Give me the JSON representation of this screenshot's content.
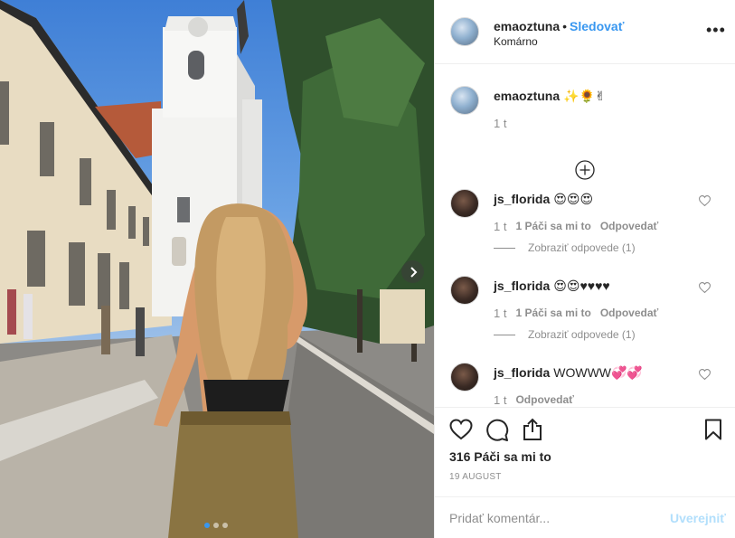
{
  "header": {
    "username": "emaoztuna",
    "separator": "•",
    "follow_label": "Sledovať",
    "location": "Komárno",
    "more_label": "•••"
  },
  "caption": {
    "username": "emaoztuna",
    "text": "✨🌻✌",
    "time": "1 t"
  },
  "comments": [
    {
      "username": "js_florida",
      "text": "😍😍😍",
      "time": "1 t",
      "likes": "1 Páči sa mi to",
      "reply": "Odpovedať",
      "view_replies": "Zobraziť odpovede (1)"
    },
    {
      "username": "js_florida",
      "text": "😍😍♥♥♥♥",
      "time": "1 t",
      "likes": "1 Páči sa mi to",
      "reply": "Odpovedať",
      "view_replies": "Zobraziť odpovede (1)"
    },
    {
      "username": "js_florida",
      "text": "WOWWW💞💞",
      "time": "1 t",
      "reply": "Odpovedať"
    }
  ],
  "likes_text": "316 Páči sa mi to",
  "date": "19 AUGUST",
  "add_comment": {
    "placeholder": "Pridať komentár...",
    "post_label": "Uverejniť"
  },
  "carousel": {
    "current": 1,
    "total": 3
  },
  "icons": [
    "heart-icon",
    "comment-icon",
    "share-icon",
    "bookmark-icon",
    "plus-circle-icon",
    "chevron-right-icon",
    "more-icon"
  ],
  "colors": {
    "accent": "#3897f0",
    "muted": "#8e8e8e",
    "text": "#262626",
    "post_disabled": "#b2dffc"
  }
}
